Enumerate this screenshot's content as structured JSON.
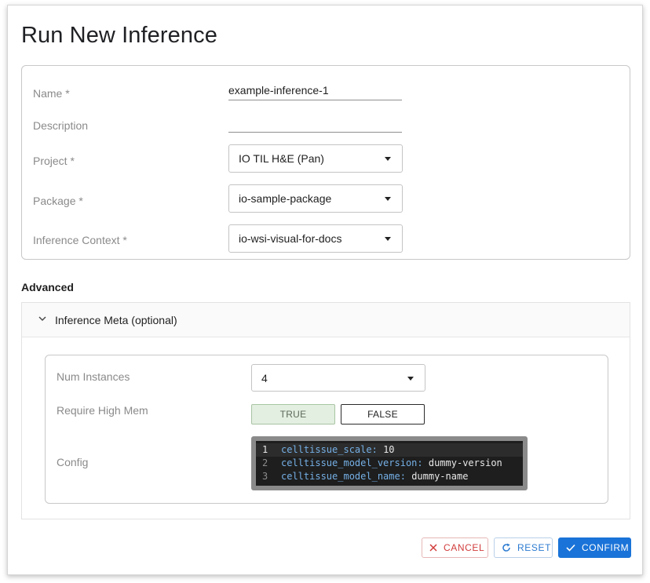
{
  "dialog": {
    "title": "Run New Inference"
  },
  "form": {
    "name": {
      "label": "Name *",
      "value": "example-inference-1"
    },
    "description": {
      "label": "Description",
      "value": ""
    },
    "project": {
      "label": "Project *",
      "value": "IO TIL H&E (Pan)"
    },
    "package": {
      "label": "Package *",
      "value": "io-sample-package"
    },
    "inference_context": {
      "label": "Inference Context *",
      "value": "io-wsi-visual-for-docs"
    }
  },
  "advanced": {
    "heading": "Advanced",
    "accordion_title": "Inference Meta (optional)",
    "expanded": true,
    "num_instances": {
      "label": "Num Instances",
      "value": "4"
    },
    "require_high_mem": {
      "label": "Require High Mem",
      "true_label": "TRUE",
      "false_label": "FALSE",
      "selected": "TRUE"
    },
    "config": {
      "label": "Config",
      "lines": [
        {
          "number": "1",
          "key": "celltissue_scale:",
          "value": "10"
        },
        {
          "number": "2",
          "key": "celltissue_model_version:",
          "value": "dummy-version"
        },
        {
          "number": "3",
          "key": "celltissue_model_name:",
          "value": "dummy-name"
        }
      ]
    }
  },
  "actions": {
    "cancel": "CANCEL",
    "reset": "RESET",
    "confirm": "CONFIRM"
  },
  "colors": {
    "primary": "#1a73d8",
    "danger": "#d23c3c",
    "selected_toggle_bg": "#e3efe1",
    "code_bg": "#1e1e1e",
    "code_key": "#75b0e6"
  },
  "icons": {
    "accordion": "chevron-down-icon",
    "select": "caret-down-icon",
    "cancel": "close-icon",
    "reset": "refresh-icon",
    "confirm": "check-icon"
  }
}
